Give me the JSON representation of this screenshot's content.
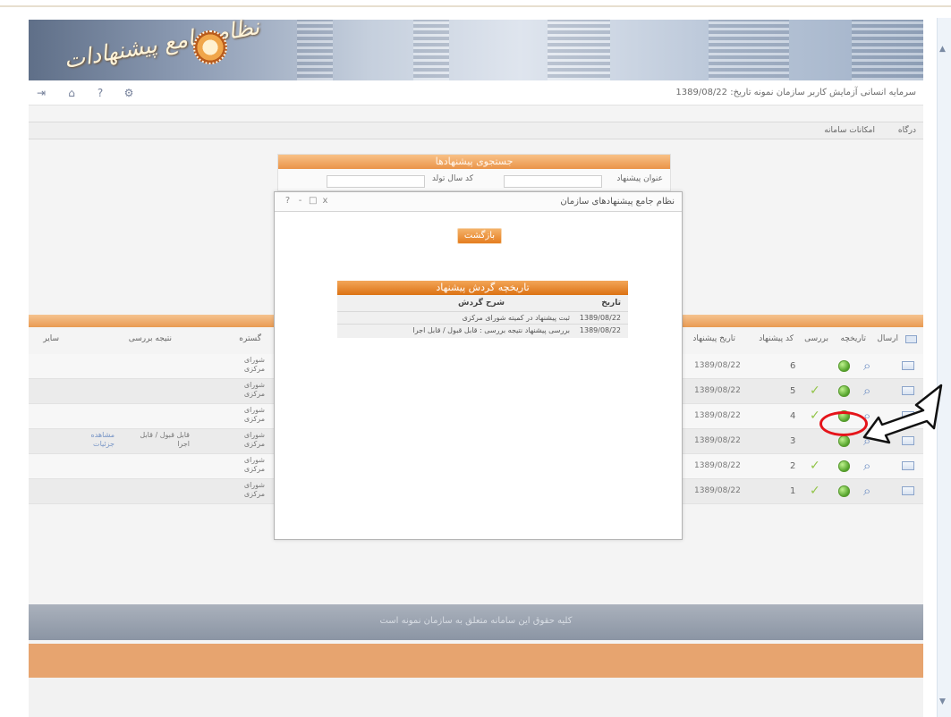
{
  "header": {
    "logo_text": "نظام جامع پیشنهادات",
    "info": "سرمایه انسانی   آزمایش کاربر   سازمان نمونه   تاریخ: 1389/08/22"
  },
  "toolbar": {
    "icons": [
      "exit-icon",
      "home-icon",
      "help-icon",
      "settings-icon"
    ]
  },
  "tabs": [
    {
      "label": "درگاه"
    },
    {
      "label": "امکانات سامانه"
    }
  ],
  "search": {
    "title": "جستجوی پیشنهادها",
    "label_1": "کد سال تولد",
    "label_2": "عنوان پیشنهاد"
  },
  "table": {
    "headers": [
      "ارسال",
      "تاریخچه",
      "بررسی",
      "کد پیشنهاد",
      "تاریخ پیشنهاد",
      "گستره",
      "نتیجه بررسی",
      "سایر"
    ],
    "rows": [
      {
        "code": "6",
        "date": "1389/08/22",
        "scope": "شورای مرکزی",
        "result": "",
        "more": "",
        "check": false
      },
      {
        "code": "5",
        "date": "1389/08/22",
        "scope": "شورای مرکزی",
        "result": "",
        "more": "",
        "check": true
      },
      {
        "code": "4",
        "date": "1389/08/22",
        "scope": "شورای مرکزی",
        "result": "",
        "more": "",
        "check": true
      },
      {
        "code": "3",
        "date": "1389/08/22",
        "scope": "شورای مرکزی",
        "result": "قابل قبول / قابل اجرا",
        "more": "مشاهده جزئیات",
        "check": false
      },
      {
        "code": "2",
        "date": "1389/08/22",
        "scope": "شورای مرکزی",
        "result": "",
        "more": "",
        "check": true
      },
      {
        "code": "1",
        "date": "1389/08/22",
        "scope": "شورای مرکزی",
        "result": "",
        "more": "",
        "check": true
      }
    ]
  },
  "footer": {
    "text": "کلیه حقوق این سامانه متعلق به سازمان نمونه است"
  },
  "modal": {
    "title": "نظام جامع پیشنهادهای سازمان",
    "controls": [
      "?",
      "-",
      "□",
      "x"
    ],
    "return_button": "بازگشت",
    "history_title": "تاریخچه گردش پیشنهاد",
    "columns": {
      "date": "تاریخ",
      "description": "شرح گردش"
    },
    "entries": [
      {
        "date": "1389/08/22",
        "description": "ثبت پیشنهاد در کمیته شورای مرکزی"
      },
      {
        "date": "1389/08/22",
        "description": "بررسی پیشنهاد نتیجه بررسی : قابل قبول / قابل اجرا"
      }
    ]
  },
  "annotation": {
    "highlight_color": "#e5141a"
  }
}
